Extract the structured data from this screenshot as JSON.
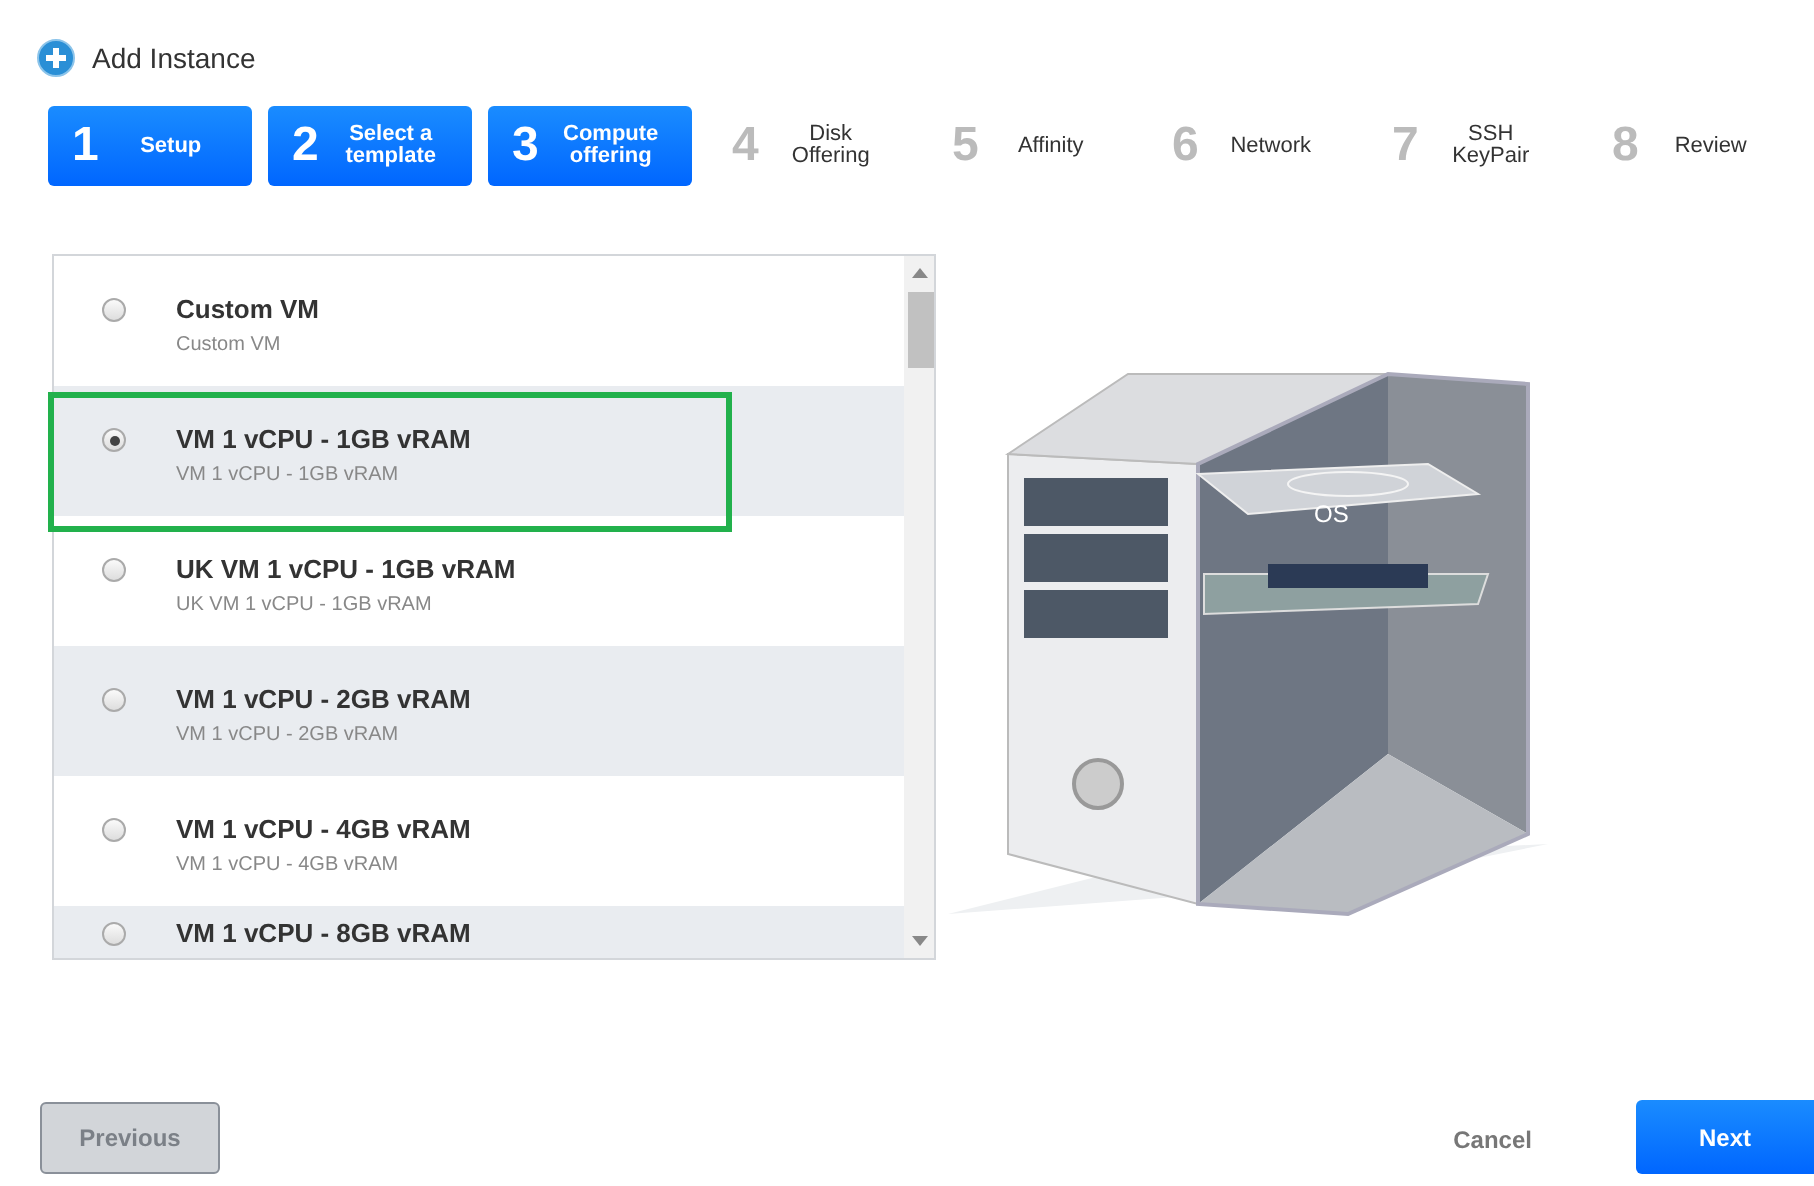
{
  "window": {
    "title": "Add Instance"
  },
  "steps": [
    {
      "number": "1",
      "label": "Setup",
      "selected": true
    },
    {
      "number": "2",
      "label": "Select a template",
      "selected": true
    },
    {
      "number": "3",
      "label": "Compute offering",
      "selected": true
    },
    {
      "number": "4",
      "label": "Disk Offering",
      "selected": false
    },
    {
      "number": "5",
      "label": "Affinity",
      "selected": false
    },
    {
      "number": "6",
      "label": "Network",
      "selected": false
    },
    {
      "number": "7",
      "label": "SSH KeyPair",
      "selected": false
    },
    {
      "number": "8",
      "label": "Review",
      "selected": false
    }
  ],
  "offerings": [
    {
      "name": "Custom VM",
      "description": "Custom VM",
      "selected": false,
      "highlighted": false
    },
    {
      "name": "VM 1 vCPU - 1GB vRAM",
      "description": "VM 1 vCPU - 1GB vRAM",
      "selected": true,
      "highlighted": true
    },
    {
      "name": "UK VM 1 vCPU - 1GB vRAM",
      "description": "UK VM 1 vCPU - 1GB vRAM",
      "selected": false,
      "highlighted": false
    },
    {
      "name": "VM 1 vCPU - 2GB vRAM",
      "description": "VM 1 vCPU - 2GB vRAM",
      "selected": false,
      "highlighted": false
    },
    {
      "name": "VM 1 vCPU - 4GB vRAM",
      "description": "VM 1 vCPU - 4GB vRAM",
      "selected": false,
      "highlighted": false
    },
    {
      "name": "VM 1 vCPU - 8GB vRAM",
      "selected": false,
      "highlighted": false
    }
  ],
  "illustration": {
    "label": "OS"
  },
  "buttons": {
    "previous": {
      "label": "Previous",
      "disabled": true
    },
    "cancel": {
      "label": "Cancel"
    },
    "next": {
      "label": "Next"
    }
  }
}
